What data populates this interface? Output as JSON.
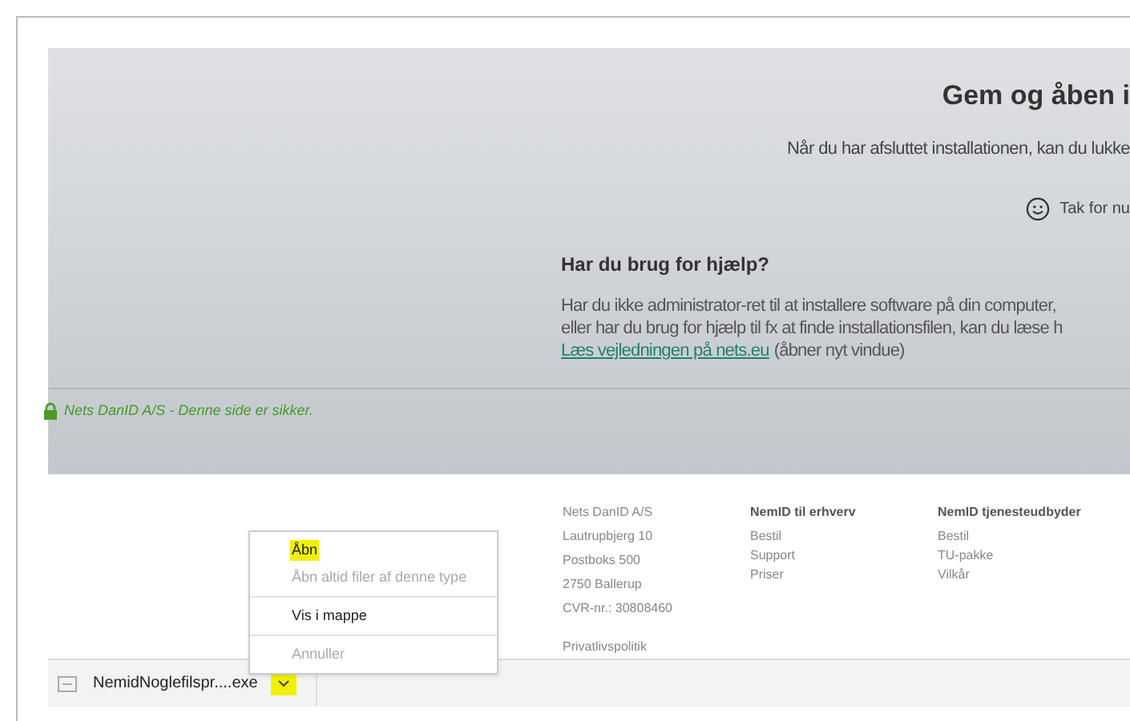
{
  "page": {
    "title": "Gem og åben i",
    "intro": "Når du har afsluttet installationen, kan du lukke",
    "thanks": "Tak for nu",
    "help_heading": "Har du brug for hjælp?",
    "help_lines": [
      "Har du ikke administrator-ret til at installere software på din computer,",
      "eller har du brug for hjælp til fx at finde installationsfilen, kan du læse h"
    ],
    "help_link": "Læs vejledningen på nets.eu",
    "help_link_note": "(åbner nyt vindue)",
    "secure_notice": "Nets DanID A/S - Denne side er sikker."
  },
  "footer": {
    "address": [
      "Nets DanID A/S",
      "Lautrupbjerg 10",
      "Postboks 500",
      "2750 Ballerup",
      "CVR-nr.: 30808460"
    ],
    "privacy": "Privatlivspolitik",
    "columns": [
      {
        "heading": "NemID til erhverv",
        "links": [
          "Bestil",
          "Support",
          "Priser"
        ]
      },
      {
        "heading": "NemID tjenesteudbyder",
        "links": [
          "Bestil",
          "TU-pakke",
          "Vilkår"
        ]
      }
    ]
  },
  "context_menu": {
    "groups": [
      [
        {
          "label": "Åbn",
          "selected": true,
          "disabled": false
        },
        {
          "label": "Åbn altid filer af denne type",
          "selected": false,
          "disabled": true
        }
      ],
      [
        {
          "label": "Vis i mappe",
          "selected": false,
          "disabled": false
        }
      ],
      [
        {
          "label": "Annuller",
          "selected": false,
          "disabled": true
        }
      ]
    ]
  },
  "download_bar": {
    "file_name": "NemidNoglefilspr....exe",
    "menu_open": true
  }
}
